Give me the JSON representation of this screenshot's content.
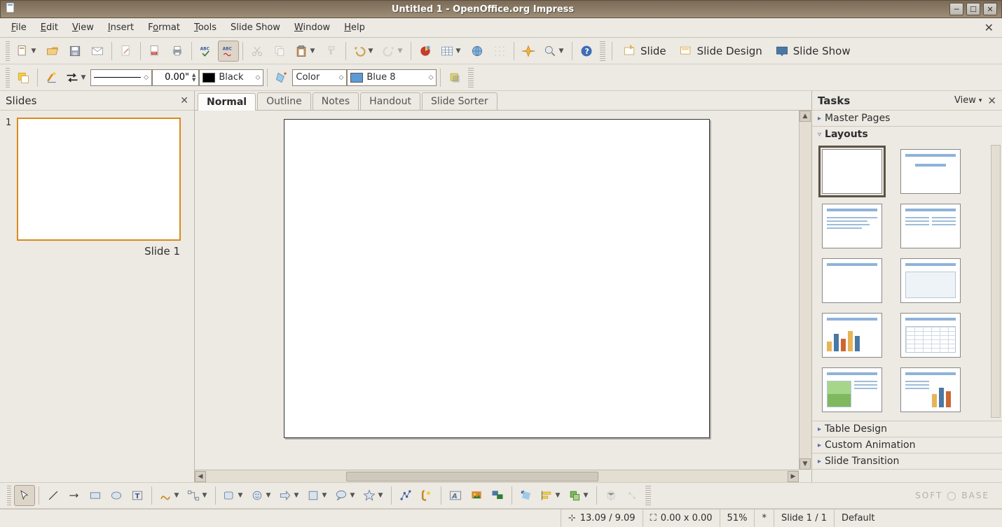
{
  "title": "Untitled 1 - OpenOffice.org Impress",
  "menu": {
    "file": "File",
    "edit": "Edit",
    "view": "View",
    "insert": "Insert",
    "format": "Format",
    "tools": "Tools",
    "slideshow": "Slide Show",
    "window": "Window",
    "help": "Help"
  },
  "toolbar_right": {
    "slide": "Slide",
    "slide_design": "Slide Design",
    "slide_show": "Slide Show"
  },
  "line_toolbar": {
    "width_value": "0.00\"",
    "line_color_label": "Black",
    "fill_mode": "Color",
    "fill_color_label": "Blue 8"
  },
  "slides_panel": {
    "title": "Slides",
    "item1_number": "1",
    "item1_caption": "Slide 1"
  },
  "view_tabs": {
    "normal": "Normal",
    "outline": "Outline",
    "notes": "Notes",
    "handout": "Handout",
    "sorter": "Slide Sorter"
  },
  "tasks": {
    "title": "Tasks",
    "view": "View",
    "master_pages": "Master Pages",
    "layouts": "Layouts",
    "table_design": "Table Design",
    "custom_animation": "Custom Animation",
    "slide_transition": "Slide Transition"
  },
  "status": {
    "pos": "13.09 / 9.09",
    "size": "0.00 x 0.00",
    "zoom": "51%",
    "modified": "*",
    "slide_n": "Slide 1 / 1",
    "template": "Default"
  },
  "watermark": "SOFT ◯ BASE",
  "colors": {
    "titlebar_bg": "#8c7c66",
    "blue8": "#5b9bd5",
    "black": "#000000"
  }
}
